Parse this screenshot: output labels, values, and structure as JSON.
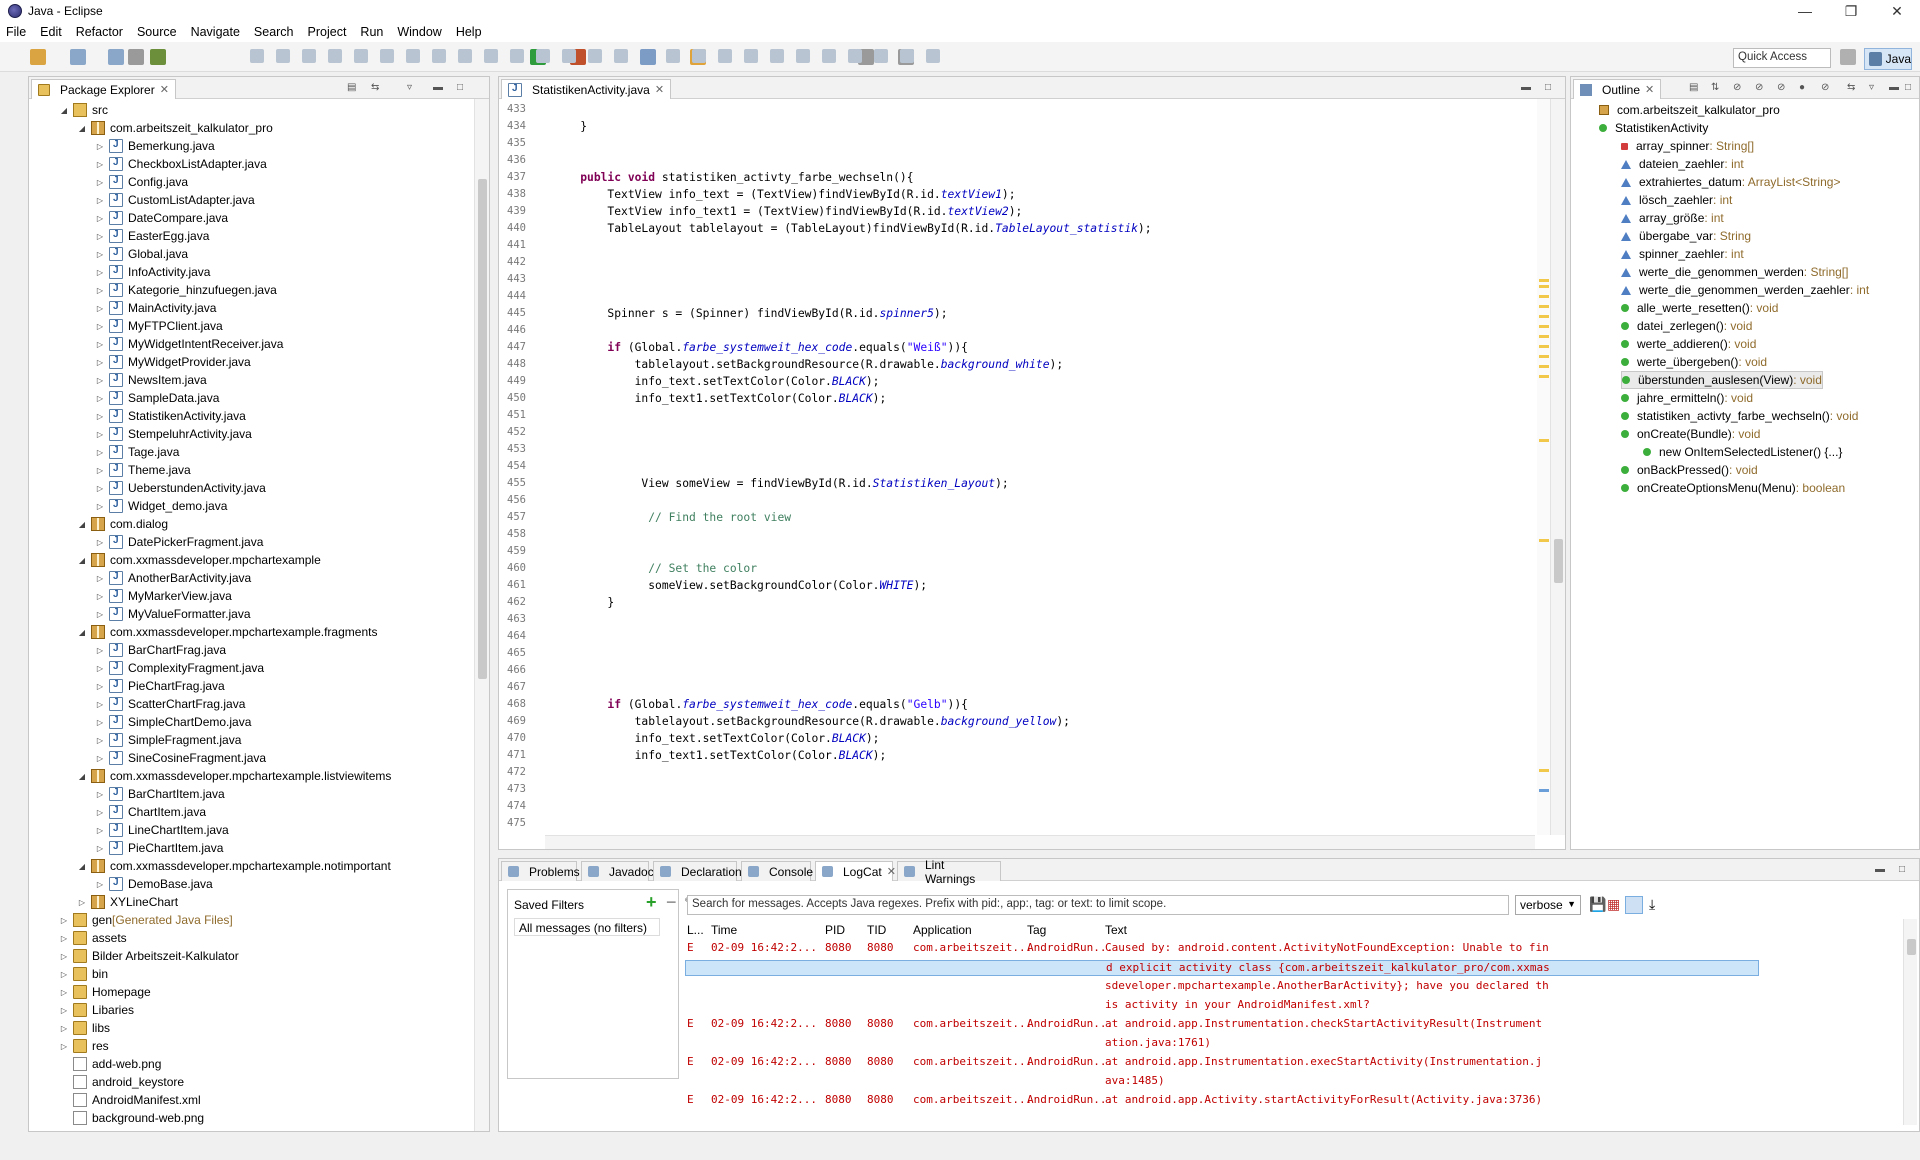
{
  "window": {
    "title": "Java - Eclipse"
  },
  "menu": [
    "File",
    "Edit",
    "Refactor",
    "Source",
    "Navigate",
    "Search",
    "Project",
    "Run",
    "Window",
    "Help"
  ],
  "toolbar": {
    "quick_access": "Quick Access",
    "perspective": "Java"
  },
  "package_explorer": {
    "tab_label": "Package Explorer",
    "items": [
      {
        "label": "src",
        "indent": 0,
        "type": "srcf",
        "open": true
      },
      {
        "label": "com.arbeitszeit_kalkulator_pro",
        "indent": 1,
        "type": "pkg",
        "open": true
      },
      {
        "label": "Bemerkung.java",
        "indent": 2,
        "type": "java"
      },
      {
        "label": "CheckboxListAdapter.java",
        "indent": 2,
        "type": "java"
      },
      {
        "label": "Config.java",
        "indent": 2,
        "type": "java"
      },
      {
        "label": "CustomListAdapter.java",
        "indent": 2,
        "type": "java"
      },
      {
        "label": "DateCompare.java",
        "indent": 2,
        "type": "java"
      },
      {
        "label": "EasterEgg.java",
        "indent": 2,
        "type": "java"
      },
      {
        "label": "Global.java",
        "indent": 2,
        "type": "java"
      },
      {
        "label": "InfoActivity.java",
        "indent": 2,
        "type": "java"
      },
      {
        "label": "Kategorie_hinzufuegen.java",
        "indent": 2,
        "type": "java"
      },
      {
        "label": "MainActivity.java",
        "indent": 2,
        "type": "java"
      },
      {
        "label": "MyFTPClient.java",
        "indent": 2,
        "type": "java"
      },
      {
        "label": "MyWidgetIntentReceiver.java",
        "indent": 2,
        "type": "java"
      },
      {
        "label": "MyWidgetProvider.java",
        "indent": 2,
        "type": "java"
      },
      {
        "label": "NewsItem.java",
        "indent": 2,
        "type": "java"
      },
      {
        "label": "SampleData.java",
        "indent": 2,
        "type": "java"
      },
      {
        "label": "StatistikenActivity.java",
        "indent": 2,
        "type": "java"
      },
      {
        "label": "StempeluhrActivity.java",
        "indent": 2,
        "type": "java"
      },
      {
        "label": "Tage.java",
        "indent": 2,
        "type": "java"
      },
      {
        "label": "Theme.java",
        "indent": 2,
        "type": "java"
      },
      {
        "label": "UeberstundenActivity.java",
        "indent": 2,
        "type": "java"
      },
      {
        "label": "Widget_demo.java",
        "indent": 2,
        "type": "java"
      },
      {
        "label": "com.dialog",
        "indent": 1,
        "type": "pkg",
        "open": true
      },
      {
        "label": "DatePickerFragment.java",
        "indent": 2,
        "type": "java"
      },
      {
        "label": "com.xxmassdeveloper.mpchartexample",
        "indent": 1,
        "type": "pkg",
        "open": true
      },
      {
        "label": "AnotherBarActivity.java",
        "indent": 2,
        "type": "java"
      },
      {
        "label": "MyMarkerView.java",
        "indent": 2,
        "type": "java"
      },
      {
        "label": "MyValueFormatter.java",
        "indent": 2,
        "type": "java"
      },
      {
        "label": "com.xxmassdeveloper.mpchartexample.fragments",
        "indent": 1,
        "type": "pkg",
        "open": true
      },
      {
        "label": "BarChartFrag.java",
        "indent": 2,
        "type": "java"
      },
      {
        "label": "ComplexityFragment.java",
        "indent": 2,
        "type": "java"
      },
      {
        "label": "PieChartFrag.java",
        "indent": 2,
        "type": "java"
      },
      {
        "label": "ScatterChartFrag.java",
        "indent": 2,
        "type": "java"
      },
      {
        "label": "SimpleChartDemo.java",
        "indent": 2,
        "type": "java"
      },
      {
        "label": "SimpleFragment.java",
        "indent": 2,
        "type": "java"
      },
      {
        "label": "SineCosineFragment.java",
        "indent": 2,
        "type": "java"
      },
      {
        "label": "com.xxmassdeveloper.mpchartexample.listviewitems",
        "indent": 1,
        "type": "pkg",
        "open": true
      },
      {
        "label": "BarChartItem.java",
        "indent": 2,
        "type": "java"
      },
      {
        "label": "ChartItem.java",
        "indent": 2,
        "type": "java"
      },
      {
        "label": "LineChartItem.java",
        "indent": 2,
        "type": "java"
      },
      {
        "label": "PieChartItem.java",
        "indent": 2,
        "type": "java"
      },
      {
        "label": "com.xxmassdeveloper.mpchartexample.notimportant",
        "indent": 1,
        "type": "pkg",
        "open": true
      },
      {
        "label": "DemoBase.java",
        "indent": 2,
        "type": "java"
      },
      {
        "label": "XYLineChart",
        "indent": 1,
        "type": "pkg"
      },
      {
        "label": "gen",
        "suffix": " [Generated Java Files]",
        "indent": 0,
        "type": "srcf"
      },
      {
        "label": "assets",
        "indent": 0,
        "type": "folder"
      },
      {
        "label": "Bilder Arbeitszeit-Kalkulator",
        "indent": 0,
        "type": "folder"
      },
      {
        "label": "bin",
        "indent": 0,
        "type": "folder"
      },
      {
        "label": "Homepage",
        "indent": 0,
        "type": "folder"
      },
      {
        "label": "Libaries",
        "indent": 0,
        "type": "folder"
      },
      {
        "label": "libs",
        "indent": 0,
        "type": "folder"
      },
      {
        "label": "res",
        "indent": 0,
        "type": "folder"
      },
      {
        "label": "add-web.png",
        "indent": 0,
        "type": "file",
        "leaf": true
      },
      {
        "label": "android_keystore",
        "indent": 0,
        "type": "file",
        "leaf": true
      },
      {
        "label": "AndroidManifest.xml",
        "indent": 0,
        "type": "file",
        "leaf": true
      },
      {
        "label": "background-web.png",
        "indent": 0,
        "type": "file",
        "leaf": true
      }
    ]
  },
  "editor": {
    "tab_label": "StatistikenActivity.java",
    "lines": [
      {
        "n": "433",
        "code": ""
      },
      {
        "n": "434",
        "code": "    }"
      },
      {
        "n": "435",
        "code": ""
      },
      {
        "n": "436",
        "code": ""
      },
      {
        "n": "437",
        "code": "    public void statistiken_activty_farbe_wechseln(){"
      },
      {
        "n": "438",
        "code": "        TextView info_text = (TextView)findViewById(R.id.textView1);"
      },
      {
        "n": "439",
        "code": "        TextView info_text1 = (TextView)findViewById(R.id.textView2);"
      },
      {
        "n": "440",
        "code": "        TableLayout tablelayout = (TableLayout)findViewById(R.id.TableLayout_statistik);"
      },
      {
        "n": "441",
        "code": ""
      },
      {
        "n": "442",
        "code": ""
      },
      {
        "n": "443",
        "code": ""
      },
      {
        "n": "444",
        "code": ""
      },
      {
        "n": "445",
        "code": "        Spinner s = (Spinner) findViewById(R.id.spinner5);"
      },
      {
        "n": "446",
        "code": ""
      },
      {
        "n": "447",
        "code": "        if (Global.farbe_systemweit_hex_code.equals(\"Weiß\")){"
      },
      {
        "n": "448",
        "code": "            tablelayout.setBackgroundResource(R.drawable.background_white);"
      },
      {
        "n": "449",
        "code": "            info_text.setTextColor(Color.BLACK);"
      },
      {
        "n": "450",
        "code": "            info_text1.setTextColor(Color.BLACK);"
      },
      {
        "n": "451",
        "code": ""
      },
      {
        "n": "452",
        "code": ""
      },
      {
        "n": "453",
        "code": ""
      },
      {
        "n": "454",
        "code": ""
      },
      {
        "n": "455",
        "code": "             View someView = findViewById(R.id.Statistiken_Layout);"
      },
      {
        "n": "456",
        "code": ""
      },
      {
        "n": "457",
        "code": "              // Find the root view"
      },
      {
        "n": "458",
        "code": ""
      },
      {
        "n": "459",
        "code": ""
      },
      {
        "n": "460",
        "code": "              // Set the color"
      },
      {
        "n": "461",
        "code": "              someView.setBackgroundColor(Color.WHITE);"
      },
      {
        "n": "462",
        "code": "        }"
      },
      {
        "n": "463",
        "code": ""
      },
      {
        "n": "464",
        "code": ""
      },
      {
        "n": "465",
        "code": ""
      },
      {
        "n": "466",
        "code": ""
      },
      {
        "n": "467",
        "code": ""
      },
      {
        "n": "468",
        "code": "        if (Global.farbe_systemweit_hex_code.equals(\"Gelb\")){"
      },
      {
        "n": "469",
        "code": "            tablelayout.setBackgroundResource(R.drawable.background_yellow);"
      },
      {
        "n": "470",
        "code": "            info_text.setTextColor(Color.BLACK);"
      },
      {
        "n": "471",
        "code": "            info_text1.setTextColor(Color.BLACK);"
      },
      {
        "n": "472",
        "code": ""
      },
      {
        "n": "473",
        "code": ""
      },
      {
        "n": "474",
        "code": ""
      },
      {
        "n": "475",
        "code": ""
      }
    ]
  },
  "outline": {
    "tab_label": "Outline",
    "items": [
      {
        "label": "com.arbeitszeit_kalkulator_pro",
        "type": "",
        "indent": 0,
        "icon": "pkg"
      },
      {
        "label": "StatistikenActivity",
        "type": "",
        "indent": 0,
        "icon": "class"
      },
      {
        "label": "array_spinner",
        "type": " : String[]",
        "indent": 1,
        "icon": "sq"
      },
      {
        "label": "dateien_zaehler",
        "type": " : int",
        "indent": 1,
        "icon": "tri"
      },
      {
        "label": "extrahiertes_datum",
        "type": " : ArrayList<String>",
        "indent": 1,
        "icon": "tri"
      },
      {
        "label": "lösch_zaehler",
        "type": " : int",
        "indent": 1,
        "icon": "tri"
      },
      {
        "label": "array_größe",
        "type": " : int",
        "indent": 1,
        "icon": "tri"
      },
      {
        "label": "übergabe_var",
        "type": " : String",
        "indent": 1,
        "icon": "tri"
      },
      {
        "label": "spinner_zaehler",
        "type": " : int",
        "indent": 1,
        "icon": "tri"
      },
      {
        "label": "werte_die_genommen_werden",
        "type": " : String[]",
        "indent": 1,
        "icon": "tri"
      },
      {
        "label": "werte_die_genommen_werden_zaehler",
        "type": " : int",
        "indent": 1,
        "icon": "tri"
      },
      {
        "label": "alle_werte_resetten()",
        "type": " : void",
        "indent": 1,
        "icon": "dot"
      },
      {
        "label": "datei_zerlegen()",
        "type": " : void",
        "indent": 1,
        "icon": "dot"
      },
      {
        "label": "werte_addieren()",
        "type": " : void",
        "indent": 1,
        "icon": "dot"
      },
      {
        "label": "werte_übergeben()",
        "type": " : void",
        "indent": 1,
        "icon": "dot"
      },
      {
        "label": "überstunden_auslesen(View)",
        "type": " : void",
        "indent": 1,
        "icon": "dot"
      },
      {
        "label": "jahre_ermitteln()",
        "type": " : void",
        "indent": 1,
        "icon": "dot"
      },
      {
        "label": "statistiken_activty_farbe_wechseln()",
        "type": " : void",
        "indent": 1,
        "icon": "dot"
      },
      {
        "label": "onCreate(Bundle)",
        "type": " : void",
        "indent": 1,
        "icon": "dot"
      },
      {
        "label": "new OnItemSelectedListener() {...}",
        "type": "",
        "indent": 2,
        "icon": "dot"
      },
      {
        "label": "onBackPressed()",
        "type": " : void",
        "indent": 1,
        "icon": "dot"
      },
      {
        "label": "onCreateOptionsMenu(Menu)",
        "type": " : boolean",
        "indent": 1,
        "icon": "dot"
      }
    ]
  },
  "bottom": {
    "tabs": [
      "Problems",
      "Javadoc",
      "Declaration",
      "Console",
      "LogCat",
      "Lint Warnings"
    ],
    "saved_filters_title": "Saved Filters",
    "saved_filter_all": "All messages (no filters)",
    "search_placeholder": "Search for messages. Accepts Java regexes. Prefix with pid:, app:, tag: or text: to limit scope.",
    "level": "verbose",
    "columns": [
      "L...",
      "Time",
      "PID",
      "TID",
      "Application",
      "Tag",
      "Text"
    ],
    "rows": [
      {
        "l": "E",
        "time": "02-09 16:42:2...",
        "pid": "8080",
        "tid": "8080",
        "app": "com.arbeitszeit...",
        "tag": "AndroidRun...",
        "text": "Caused by: android.content.ActivityNotFoundException: Unable to fin"
      },
      {
        "l": "",
        "time": "",
        "pid": "",
        "tid": "",
        "app": "",
        "tag": "",
        "text": "d explicit activity class {com.arbeitszeit_kalkulator_pro/com.xxmas",
        "selected": true
      },
      {
        "l": "",
        "time": "",
        "pid": "",
        "tid": "",
        "app": "",
        "tag": "",
        "text": "sdeveloper.mpchartexample.AnotherBarActivity}; have you declared th"
      },
      {
        "l": "",
        "time": "",
        "pid": "",
        "tid": "",
        "app": "",
        "tag": "",
        "text": "is activity in your AndroidManifest.xml?"
      },
      {
        "l": "E",
        "time": "02-09 16:42:2...",
        "pid": "8080",
        "tid": "8080",
        "app": "com.arbeitszeit...",
        "tag": "AndroidRun...",
        "text": "at android.app.Instrumentation.checkStartActivityResult(Instrument"
      },
      {
        "l": "",
        "time": "",
        "pid": "",
        "tid": "",
        "app": "",
        "tag": "",
        "text": "ation.java:1761)"
      },
      {
        "l": "E",
        "time": "02-09 16:42:2...",
        "pid": "8080",
        "tid": "8080",
        "app": "com.arbeitszeit...",
        "tag": "AndroidRun...",
        "text": "at android.app.Instrumentation.execStartActivity(Instrumentation.j"
      },
      {
        "l": "",
        "time": "",
        "pid": "",
        "tid": "",
        "app": "",
        "tag": "",
        "text": "ava:1485)"
      },
      {
        "l": "E",
        "time": "02-09 16:42:2...",
        "pid": "8080",
        "tid": "8080",
        "app": "com.arbeitszeit...",
        "tag": "AndroidRun...",
        "text": "at android.app.Activity.startActivityForResult(Activity.java:3736)"
      }
    ]
  }
}
